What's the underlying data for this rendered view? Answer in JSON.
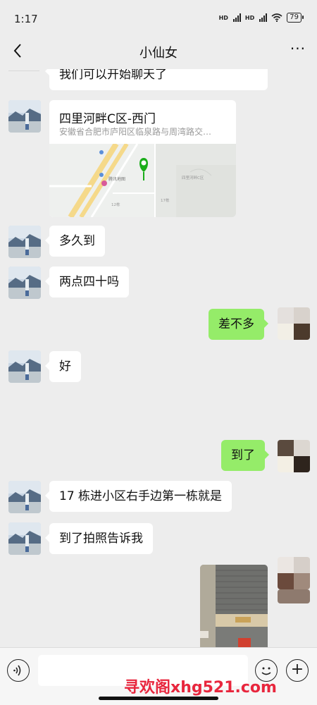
{
  "status_bar": {
    "time": "1:17",
    "signal_1": "HD",
    "signal_2": "HD",
    "battery": "79"
  },
  "header": {
    "title": "小仙女",
    "back_icon": "chevron-left-icon",
    "more_icon": "ellipsis-icon",
    "more_text": "···"
  },
  "messages": [
    {
      "side": "left",
      "type": "text",
      "text": "我们可以开始聊天了"
    },
    {
      "side": "left",
      "type": "location",
      "title": "四里河畔C区-西门",
      "address": "安徽省合肥市庐阳区临泉路与周湾路交…"
    },
    {
      "side": "left",
      "type": "text",
      "text": "多久到"
    },
    {
      "side": "left",
      "type": "text",
      "text": "两点四十吗"
    },
    {
      "side": "right",
      "type": "text",
      "text": "差不多"
    },
    {
      "side": "left",
      "type": "text",
      "text": "好"
    },
    {
      "side": "right",
      "type": "text",
      "text": "到了"
    },
    {
      "side": "left",
      "type": "text",
      "text": "17 栋进小区右手边第一栋就是"
    },
    {
      "side": "left",
      "type": "text",
      "text": "到了拍照告诉我"
    },
    {
      "side": "right",
      "type": "image"
    }
  ],
  "map_labels": {
    "poi_1": "腾讯地图",
    "poi_2": "四里河畔C区",
    "poi_3": "17栋",
    "poi_4": "12栋"
  },
  "input_bar": {
    "voice_icon": "voice-icon",
    "placeholder": "",
    "emoji_icon": "emoji-icon",
    "plus_icon": "plus-icon",
    "plus_text": "+"
  },
  "watermark": "寻欢阁xhg521.com",
  "colors": {
    "background": "#ededed",
    "bubble_right": "#95ec69",
    "bubble_left": "#ffffff",
    "map_pin": "#1aad19",
    "watermark": "#e8263d"
  }
}
